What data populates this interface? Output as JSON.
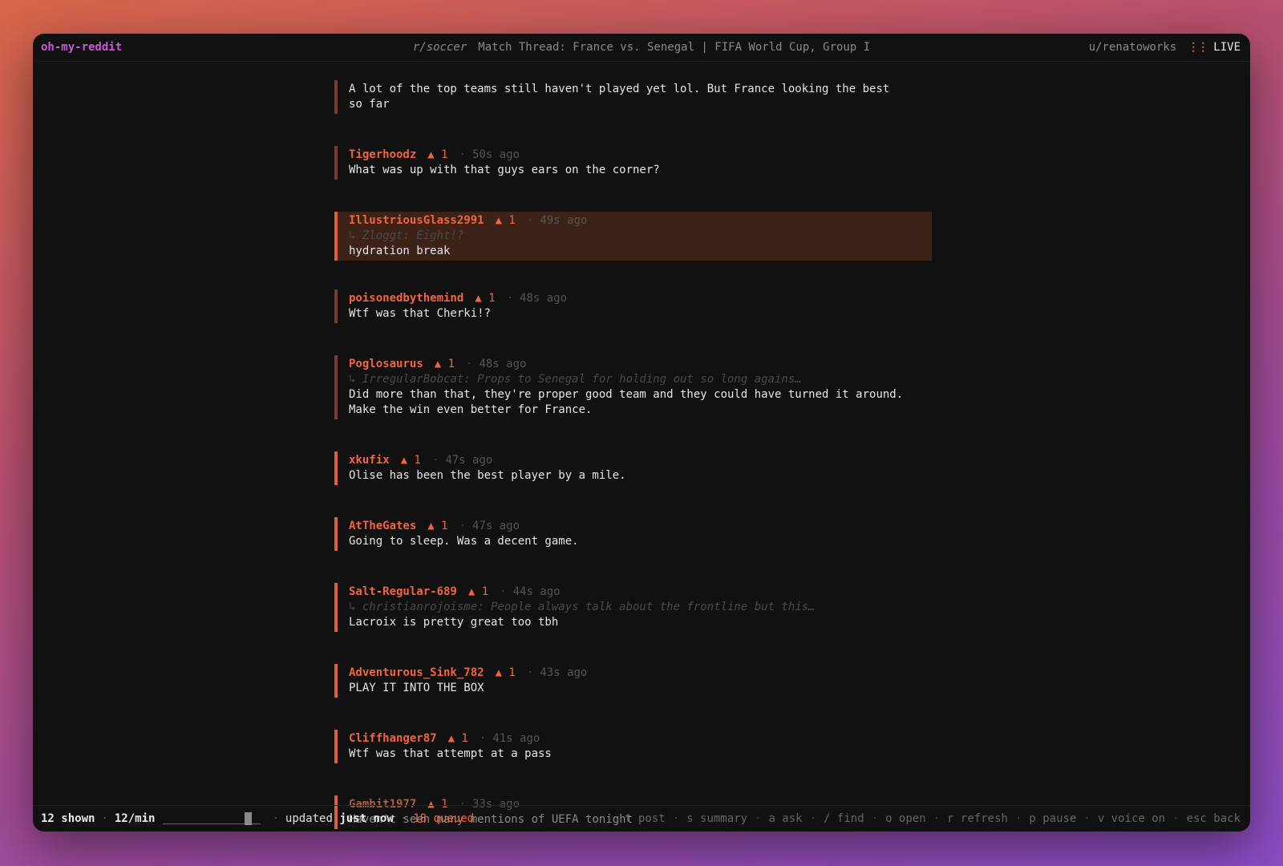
{
  "header": {
    "app_name": "oh-my-reddit",
    "subreddit": "r/soccer",
    "thread_title": "Match Thread: France vs. Senegal | FIFA World Cup, Group I",
    "username": "u/renatoworks",
    "live_label": "LIVE",
    "live_icon": "⋮⋮"
  },
  "comments": [
    {
      "author": "",
      "votes": "",
      "age": "",
      "reply": "",
      "body": "A lot of the top teams still haven't played yet lol. But France looking the best\nso far"
    },
    {
      "author": "Tigerhoodz",
      "votes": "▲ 1",
      "age": "50s ago",
      "reply": "",
      "body": "What was up with that guys ears on the corner?"
    },
    {
      "author": "IllustriousGlass2991",
      "votes": "▲ 1",
      "age": "49s ago",
      "reply": "↳ Zloggt: Eight!?",
      "body": "hydration break"
    },
    {
      "author": "poisonedbythemind",
      "votes": "▲ 1",
      "age": "48s ago",
      "reply": "",
      "body": "Wtf was that Cherki!?"
    },
    {
      "author": "Poglosaurus",
      "votes": "▲ 1",
      "age": "48s ago",
      "reply": "↳ IrregularBobcat: Props to Senegal for holding out so long agains…",
      "body": "Did more than that, they're proper good team and they could have turned it around.\nMake the win even better for France."
    },
    {
      "author": "xkufix",
      "votes": "▲ 1",
      "age": "47s ago",
      "reply": "",
      "body": "Olise has been the best player by a mile."
    },
    {
      "author": "AtTheGates",
      "votes": "▲ 1",
      "age": "47s ago",
      "reply": "",
      "body": "Going to sleep. Was a decent game."
    },
    {
      "author": "Salt-Regular-689",
      "votes": "▲ 1",
      "age": "44s ago",
      "reply": "↳ christianrojoisme: People always talk about the frontline but this…",
      "body": "Lacroix is pretty great too tbh"
    },
    {
      "author": "Adventurous_Sink_782",
      "votes": "▲ 1",
      "age": "43s ago",
      "reply": "",
      "body": "PLAY IT INTO THE BOX"
    },
    {
      "author": "Cliffhanger87",
      "votes": "▲ 1",
      "age": "41s ago",
      "reply": "",
      "body": "Wtf was that attempt at a pass"
    },
    {
      "author": "Gambit1977",
      "votes": "▲ 1",
      "age": "33s ago",
      "reply": "",
      "body": "Haven't seen many mentions of UEFA tonight"
    }
  ],
  "status": {
    "shown": "12 shown",
    "rate": "12/min",
    "progress_fraction": 0.9,
    "updated_prefix": "updated",
    "updated_value": "just now",
    "queued": "18 queued",
    "shortcuts": [
      "t post",
      "s summary",
      "a ask",
      "/ find",
      "o open",
      "r refresh",
      "p pause",
      "v voice on",
      "esc back"
    ]
  },
  "colors": {
    "accent": "#f0653d",
    "app_name": "#c75bd6",
    "highlight_bg": "#3d2217",
    "window_bg": "#111111"
  }
}
